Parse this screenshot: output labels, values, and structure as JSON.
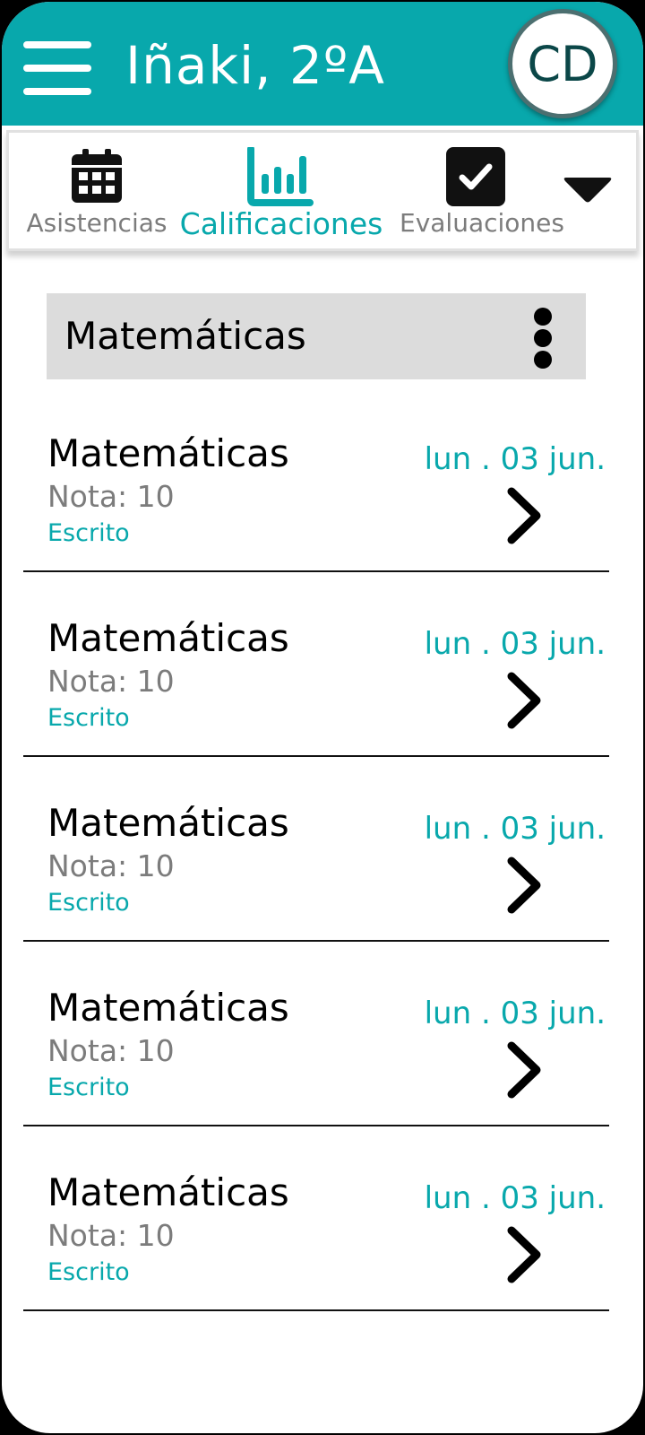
{
  "header": {
    "title": "Iñaki, 2ºA",
    "avatar_initials": "CD",
    "color": "#08a8ac"
  },
  "tabs": [
    {
      "label": "Asistencias",
      "icon": "calendar-icon",
      "active": false
    },
    {
      "label": "Calificaciones",
      "icon": "bar-chart-icon",
      "active": true
    },
    {
      "label": "Evaluaciones",
      "icon": "checkbox-icon",
      "active": false
    }
  ],
  "section": {
    "title": "Matemáticas"
  },
  "grades": [
    {
      "subject": "Matemáticas",
      "note": "Nota: 10",
      "type": "Escrito",
      "date": "lun . 03 jun."
    },
    {
      "subject": "Matemáticas",
      "note": "Nota: 10",
      "type": "Escrito",
      "date": "lun . 03 jun."
    },
    {
      "subject": "Matemáticas",
      "note": "Nota: 10",
      "type": "Escrito",
      "date": "lun . 03 jun."
    },
    {
      "subject": "Matemáticas",
      "note": "Nota: 10",
      "type": "Escrito",
      "date": "lun . 03 jun."
    },
    {
      "subject": "Matemáticas",
      "note": "Nota: 10",
      "type": "Escrito",
      "date": "lun . 03 jun."
    }
  ],
  "colors": {
    "accent": "#08a8ac",
    "muted_text": "#7c7c7c",
    "section_bg": "#dcdcdc"
  }
}
